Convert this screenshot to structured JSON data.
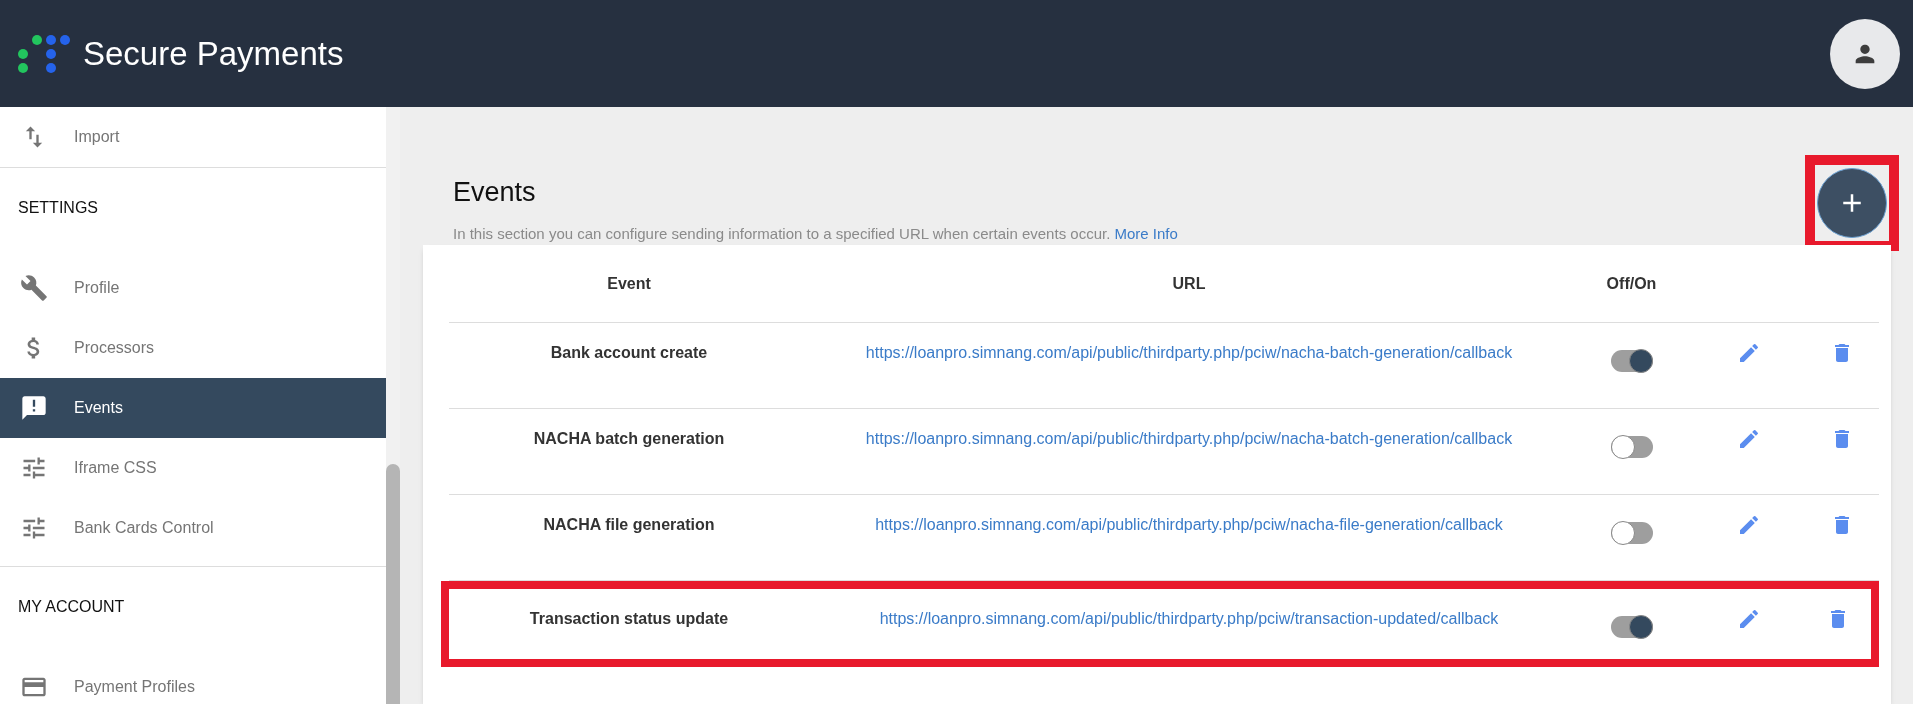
{
  "header": {
    "brand": "Secure Payments"
  },
  "sidebar": {
    "sections": [
      {
        "items": [
          {
            "label": "Import",
            "kind": "import",
            "selected": false
          }
        ]
      },
      {
        "title": "SETTINGS",
        "items": [
          {
            "label": "Profile",
            "kind": "wrench",
            "selected": false
          },
          {
            "label": "Processors",
            "kind": "dollar",
            "selected": false
          },
          {
            "label": "Events",
            "kind": "alert",
            "selected": true
          },
          {
            "label": "Iframe CSS",
            "kind": "tune",
            "selected": false
          },
          {
            "label": "Bank Cards Control",
            "kind": "tune",
            "selected": false
          }
        ]
      },
      {
        "title": "MY ACCOUNT",
        "items": [
          {
            "label": "Payment Profiles",
            "kind": "card",
            "selected": false
          }
        ]
      }
    ]
  },
  "page": {
    "title": "Events",
    "description": "In this section you can configure sending information to a specified URL when certain events occur.",
    "link": "More Info",
    "add_highlighted": true
  },
  "table": {
    "columns": [
      "Event",
      "URL",
      "Off/On"
    ],
    "rows": [
      {
        "event": "Bank account create",
        "url": "https://loanpro.simnang.com/api/public/thirdparty.php/pciw/nacha-batch-generation/callback",
        "on": true,
        "highlighted": false
      },
      {
        "event": "NACHA batch generation",
        "url": "https://loanpro.simnang.com/api/public/thirdparty.php/pciw/nacha-batch-generation/callback",
        "on": false,
        "highlighted": false
      },
      {
        "event": "NACHA file generation",
        "url": "https://loanpro.simnang.com/api/public/thirdparty.php/pciw/nacha-file-generation/callback",
        "on": false,
        "highlighted": false
      },
      {
        "event": "Transaction status update",
        "url": "https://loanpro.simnang.com/api/public/thirdparty.php/pciw/transaction-updated/callback",
        "on": true,
        "highlighted": true
      }
    ]
  }
}
